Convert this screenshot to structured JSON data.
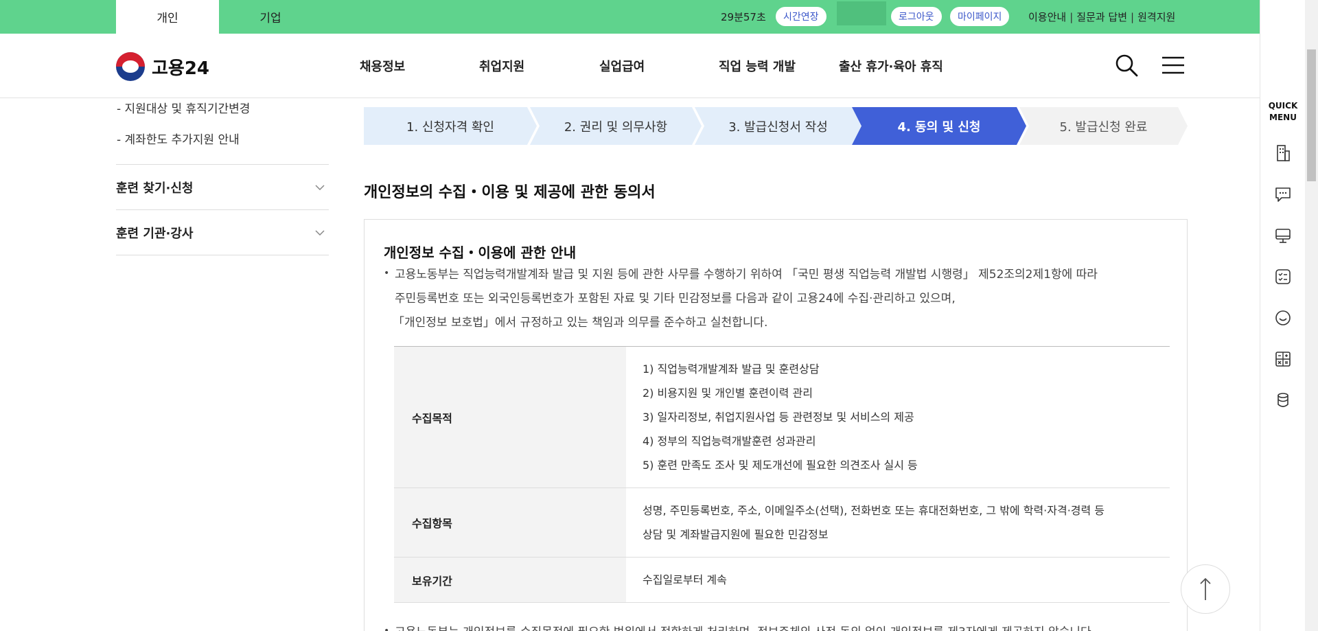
{
  "topbar": {
    "tabs": [
      "개인",
      "기업"
    ],
    "timer": "29분57초",
    "extend_label": "시간연장",
    "logout_label": "로그아웃",
    "mypage_label": "마이페이지",
    "links": [
      "이용안내",
      "질문과 답변",
      "원격지원"
    ],
    "bg_color": "#5fd38d"
  },
  "header": {
    "logo_text": "고용24",
    "nav": [
      "채용정보",
      "취업지원",
      "실업급여",
      "직업 능력 개발",
      "출산 휴가·육아 휴직"
    ]
  },
  "sidebar": {
    "subitems": [
      "- 지원대상 및 휴직기간변경",
      "- 계좌한도 추가지원 안내"
    ],
    "sections": [
      "훈련 찾기·신청",
      "훈련 기관·강사"
    ]
  },
  "steps": [
    {
      "label": "1. 신청자격 확인",
      "state": "done"
    },
    {
      "label": "2. 권리 및 의무사항",
      "state": "done"
    },
    {
      "label": "3. 발급신청서 작성",
      "state": "done"
    },
    {
      "label": "4. 동의 및 신청",
      "state": "active"
    },
    {
      "label": "5. 발급신청 완료",
      "state": "todo"
    }
  ],
  "content": {
    "title": "개인정보의 수집・이용 및 제공에 관한 동의서",
    "box_title": "개인정보 수집・이용에 관한 안내",
    "intro_lines": [
      "고용노동부는 직업능력개발계좌 발급 및 지원 등에 관한 사무를 수행하기 위하여 「국민 평생 직업능력 개발법 시행령」 제52조의2제1항에 따라",
      "주민등록번호 또는 외국인등록번호가 포함된 자료 및 기타 민감정보를 다음과 같이 고용24에 수집·관리하고 있으며,",
      "「개인정보 보호법」에서 규정하고 있는 책임과 의무를 준수하고 실천합니다."
    ],
    "table": {
      "purpose_label": "수집목적",
      "purpose_items": [
        "1) 직업능력개발계좌 발급 및 훈련상담",
        "2) 비용지원 및 개인별 훈련이력 관리",
        "3) 일자리정보, 취업지원사업 등 관련정보 및 서비스의 제공",
        "4) 정부의 직업능력개발훈련 성과관리",
        "5) 훈련 만족도 조사 및 제도개선에 필요한 의견조사 실시 등"
      ],
      "items_label": "수집항목",
      "items_lines": [
        "성명, 주민등록번호, 주소, 이메일주소(선택), 전화번호 또는 휴대전화번호, 그 밖에 학력·자격·경력 등",
        "상담 및 계좌발급지원에 필요한 민감정보"
      ],
      "period_label": "보유기간",
      "period_value": "수집일로부터 계속"
    },
    "footer_line": "고용노동부는 개인정보를 수집목적에 필요한 범위에서 적합하게 처리하며, 정보주체의 사전 동의 없이 개인정보를 제3자에게 제공하지 않습니다."
  },
  "quick": {
    "title_line1": "QUICK",
    "title_line2": "MENU",
    "icons": [
      "building-icon",
      "chat-icon",
      "monitor-icon",
      "checklist-icon",
      "smile-icon",
      "calculator-icon",
      "coins-icon"
    ]
  },
  "colors": {
    "step_done": "#e3eefa",
    "step_active": "#4060d8",
    "step_todo": "#f2f2f2"
  }
}
